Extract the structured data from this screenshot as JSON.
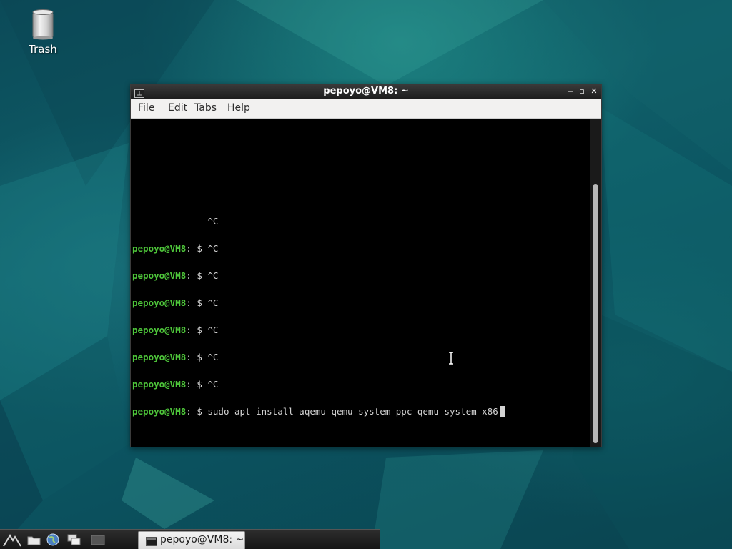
{
  "desktop": {
    "icons": [
      {
        "label": "Trash",
        "icon": "trash-icon"
      }
    ]
  },
  "window": {
    "title": "pepoyo@VM8: ~",
    "controls": {
      "minimize": "‒",
      "maximize": "▫",
      "close": "✕"
    },
    "menu": [
      "File",
      "Edit",
      "Tabs",
      "Help"
    ]
  },
  "terminal": {
    "prompt_user": "pepoyo@VM8",
    "prompt_sep": ": $ ",
    "first_line": "              ^C",
    "lines": [
      "^C",
      "^C",
      "^C",
      "^C",
      "^C",
      "^C"
    ],
    "current_command": "sudo apt install aqemu qemu-system-ppc qemu-system-x86"
  },
  "taskbar": {
    "launchers": [
      "start-menu-icon",
      "file-manager-icon",
      "web-browser-icon",
      "window-switcher-icon",
      "show-desktop-icon"
    ],
    "task_label": "pepoyo@VM8: ~"
  },
  "colors": {
    "prompt_green": "#4ec63a",
    "terminal_text": "#d3d3d3",
    "terminal_bg": "#000000",
    "titlebar": "#2a2a2a"
  }
}
